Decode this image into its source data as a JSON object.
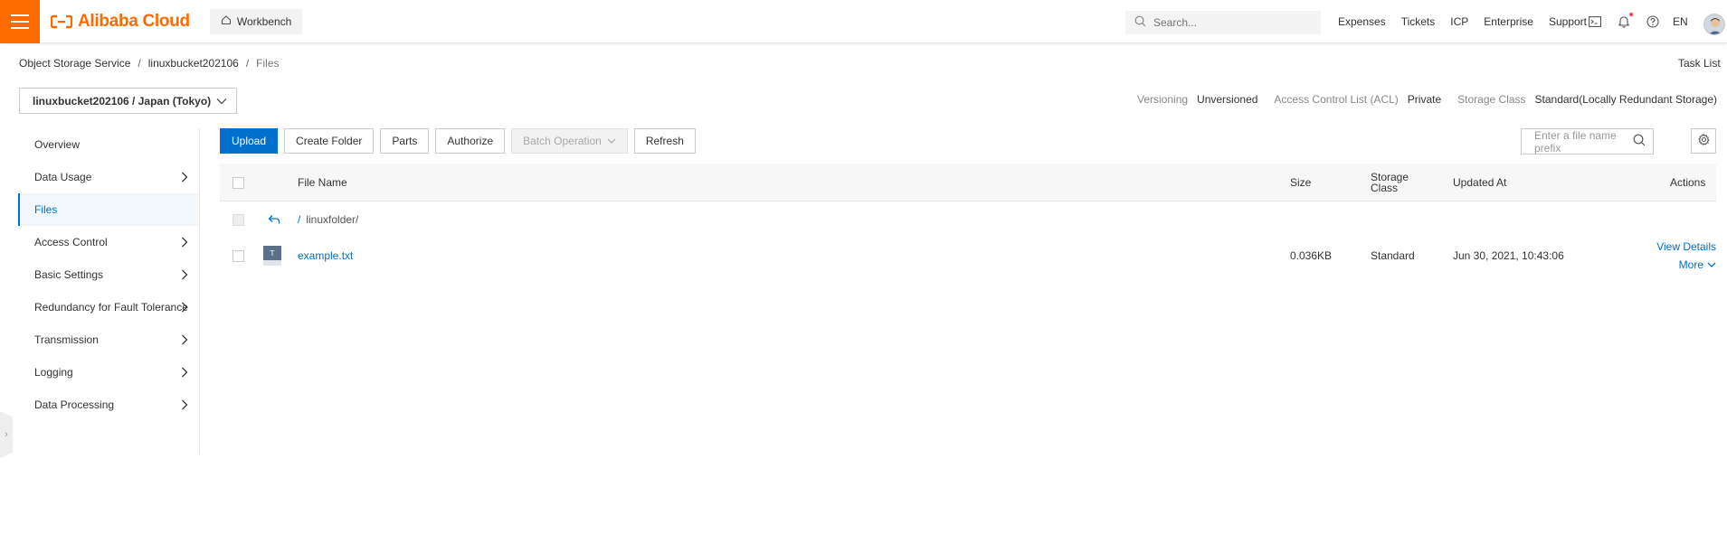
{
  "header": {
    "logo_text": "Alibaba Cloud",
    "workbench_label": "Workbench",
    "search_placeholder": "Search...",
    "links": [
      "Expenses",
      "Tickets",
      "ICP",
      "Enterprise",
      "Support"
    ],
    "lang": "EN",
    "accent_color": "#ff6a00"
  },
  "breadcrumb": {
    "items": [
      "Object Storage Service",
      "linuxbucket202106",
      "Files"
    ],
    "separator": "/"
  },
  "task_list_label": "Task List",
  "bucket": {
    "selected": "linuxbucket202106 / Japan (Tokyo)",
    "meta": [
      {
        "label": "Versioning",
        "value": "Unversioned"
      },
      {
        "label": "Access Control List (ACL)",
        "value": "Private"
      },
      {
        "label": "Storage Class",
        "value": "Standard(Locally Redundant Storage)"
      }
    ]
  },
  "sidebar": {
    "items": [
      {
        "label": "Overview",
        "has_children": false,
        "active": false
      },
      {
        "label": "Data Usage",
        "has_children": true,
        "active": false
      },
      {
        "label": "Files",
        "has_children": false,
        "active": true
      },
      {
        "label": "Access Control",
        "has_children": true,
        "active": false
      },
      {
        "label": "Basic Settings",
        "has_children": true,
        "active": false
      },
      {
        "label": "Redundancy for Fault Tolerance",
        "has_children": true,
        "active": false
      },
      {
        "label": "Transmission",
        "has_children": true,
        "active": false
      },
      {
        "label": "Logging",
        "has_children": true,
        "active": false
      },
      {
        "label": "Data Processing",
        "has_children": true,
        "active": false
      }
    ]
  },
  "toolbar": {
    "upload": "Upload",
    "create_folder": "Create Folder",
    "parts": "Parts",
    "authorize": "Authorize",
    "batch_operation": "Batch Operation",
    "refresh": "Refresh",
    "file_search_placeholder": "Enter a file name prefix"
  },
  "table": {
    "columns": {
      "file_name": "File Name",
      "size": "Size",
      "storage_class": "Storage Class",
      "updated_at": "Updated At",
      "actions": "Actions"
    },
    "parent_row": {
      "path_prefix": "/",
      "folder": "linuxfolder/"
    },
    "rows": [
      {
        "name": "example.txt",
        "size": "0.036KB",
        "storage_class": "Standard",
        "updated_at": "Jun 30, 2021, 10:43:06",
        "action_details": "View Details",
        "action_more": "More"
      }
    ]
  },
  "colors": {
    "primary": "#0070cc",
    "brand": "#ff6a00"
  }
}
